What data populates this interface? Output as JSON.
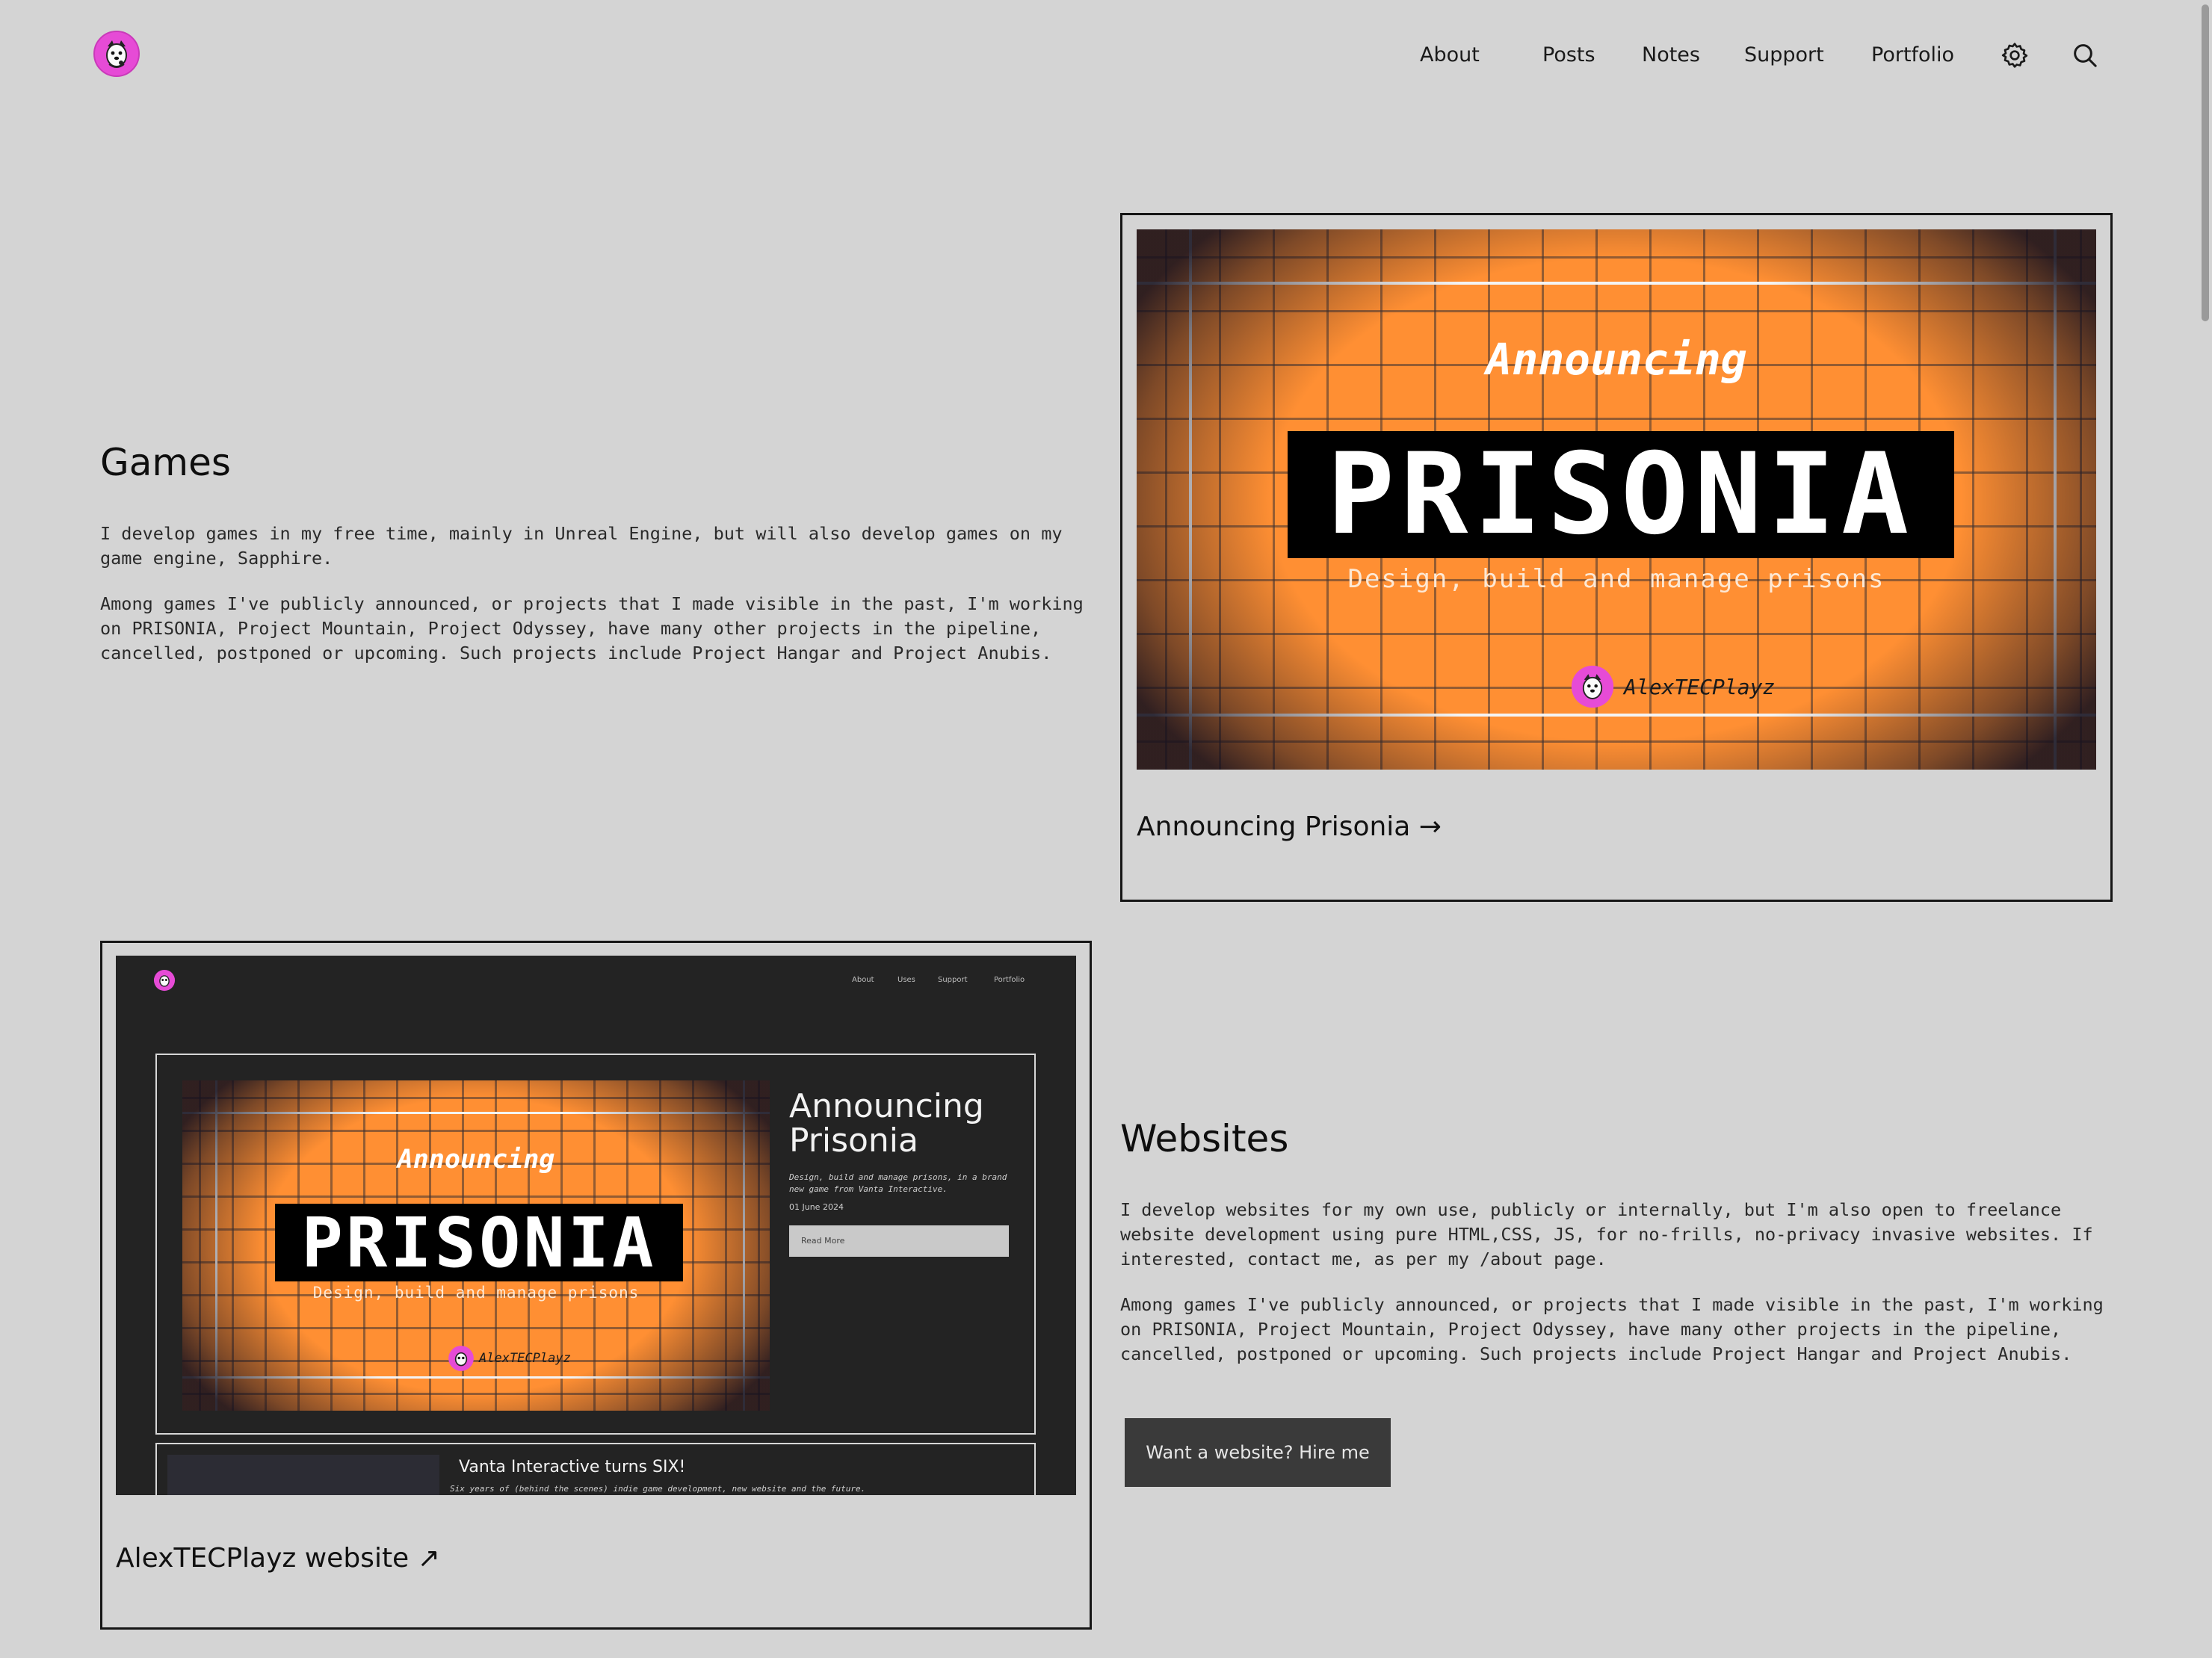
{
  "header": {
    "nav": [
      {
        "label": "About"
      },
      {
        "label": "Posts"
      },
      {
        "label": "Notes"
      },
      {
        "label": "Support"
      },
      {
        "label": "Portfolio"
      }
    ],
    "icons": [
      "settings-icon",
      "search-icon"
    ]
  },
  "games": {
    "title": "Games",
    "paragraphs": [
      "I develop games in my free time, mainly in Unreal Engine, but will also develop games on my game engine, Sapphire.",
      "Among games I've publicly announced, or projects that I made visible in the past, I'm working on PRISONIA, Project Mountain, Project Odyssey, have many other projects in the pipeline, cancelled, postponed or upcoming. Such projects include Project Hangar and Project Anubis."
    ],
    "card": {
      "announce": "Announcing",
      "logo": "PRISONIA",
      "tagline": "Design, build and manage prisons",
      "brand": "AlexTECPlayz",
      "link": "Announcing Prisonia →"
    }
  },
  "websites": {
    "title": "Websites",
    "paragraphs": [
      "I develop websites for my own use, publicly or internally, but I'm also open to freelance website development using pure HTML,CSS, JS, for no-frills, no-privacy invasive websites. If interested, contact me, as per my /about page.",
      "Among games I've publicly announced, or projects that I made visible in the past, I'm working on PRISONIA, Project Mountain, Project Odyssey, have many other projects in the pipeline, cancelled, postponed or upcoming. Such projects include Project Hangar and Project Anubis."
    ],
    "button": "Want a website? Hire me",
    "card": {
      "link": "AlexTECPlayz website ↗",
      "screenshot": {
        "nav": [
          "About",
          "Uses",
          "Support",
          "Portfolio"
        ],
        "post_title": "Announcing Prisonia",
        "post_desc": "Design, build and manage prisons, in a brand new game from Vanta Interactive.",
        "post_date": "01 June 2024",
        "read_more": "Read More",
        "promo": {
          "announce": "Announcing",
          "logo": "PRISONIA",
          "tagline": "Design, build and manage prisons",
          "brand": "AlexTECPlayz"
        },
        "post2_title": "Vanta Interactive turns SIX!",
        "post2_desc": "Six years of (behind the scenes) indie game development, new website and the future."
      }
    }
  },
  "colors": {
    "background": "#d4d4d4",
    "accent_orange": "#ff8f33",
    "logo_pink": "#e64bd6",
    "button": "#3a3a3a",
    "dark_panel": "#232323"
  }
}
